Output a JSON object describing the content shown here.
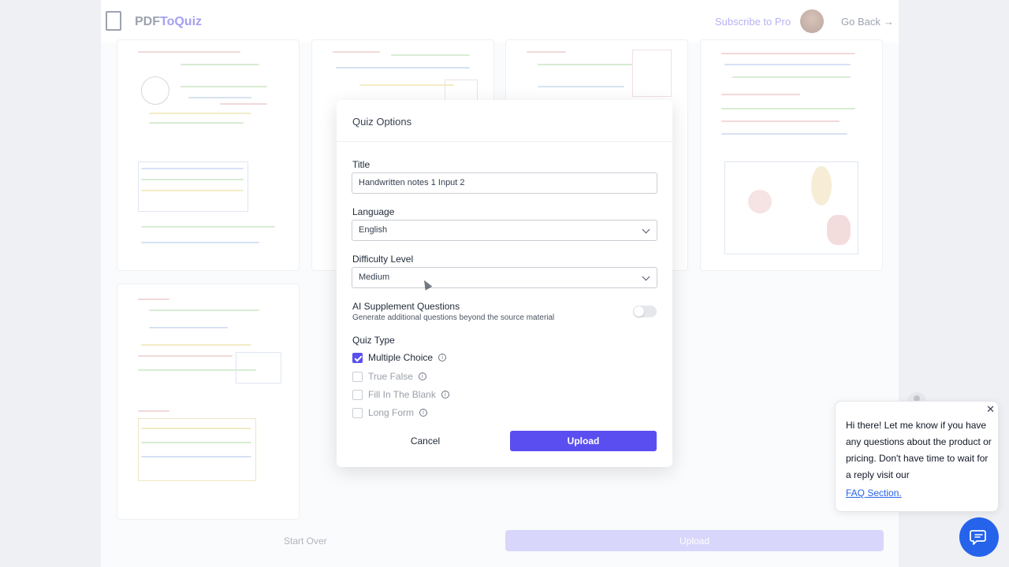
{
  "app": {
    "logo_plain": "PDF",
    "logo_accent": "ToQuiz",
    "subscribe": "Subscribe to Pro",
    "go_back": "Go Back",
    "go_back_icon": "arrow-right-icon"
  },
  "footer": {
    "start_over": "Start Over",
    "upload": "Upload"
  },
  "modal": {
    "title": "Quiz Options",
    "title_field": {
      "label": "Title",
      "value": "Handwritten notes 1 Input 2"
    },
    "language": {
      "label": "Language",
      "value": "English"
    },
    "difficulty": {
      "label": "Difficulty Level",
      "value": "Medium"
    },
    "ai_supplement": {
      "label": "AI Supplement Questions",
      "description": "Generate additional questions beyond the source material",
      "enabled": false
    },
    "quiz_type": {
      "label": "Quiz Type",
      "options": [
        {
          "label": "Multiple Choice",
          "checked": true
        },
        {
          "label": "True False",
          "checked": false
        },
        {
          "label": "Fill In The Blank",
          "checked": false
        },
        {
          "label": "Long Form",
          "checked": false
        }
      ]
    },
    "cancel": "Cancel",
    "upload": "Upload"
  },
  "chat": {
    "message": "Hi there! Let me know if you have any questions about the product or pricing. Don't have time to wait for a reply visit our",
    "link": "FAQ Section.",
    "close_icon": "close-icon",
    "launcher_icon": "chat-bubble-icon"
  },
  "colors": {
    "accent": "#5b4ef0",
    "link": "#2563eb"
  }
}
